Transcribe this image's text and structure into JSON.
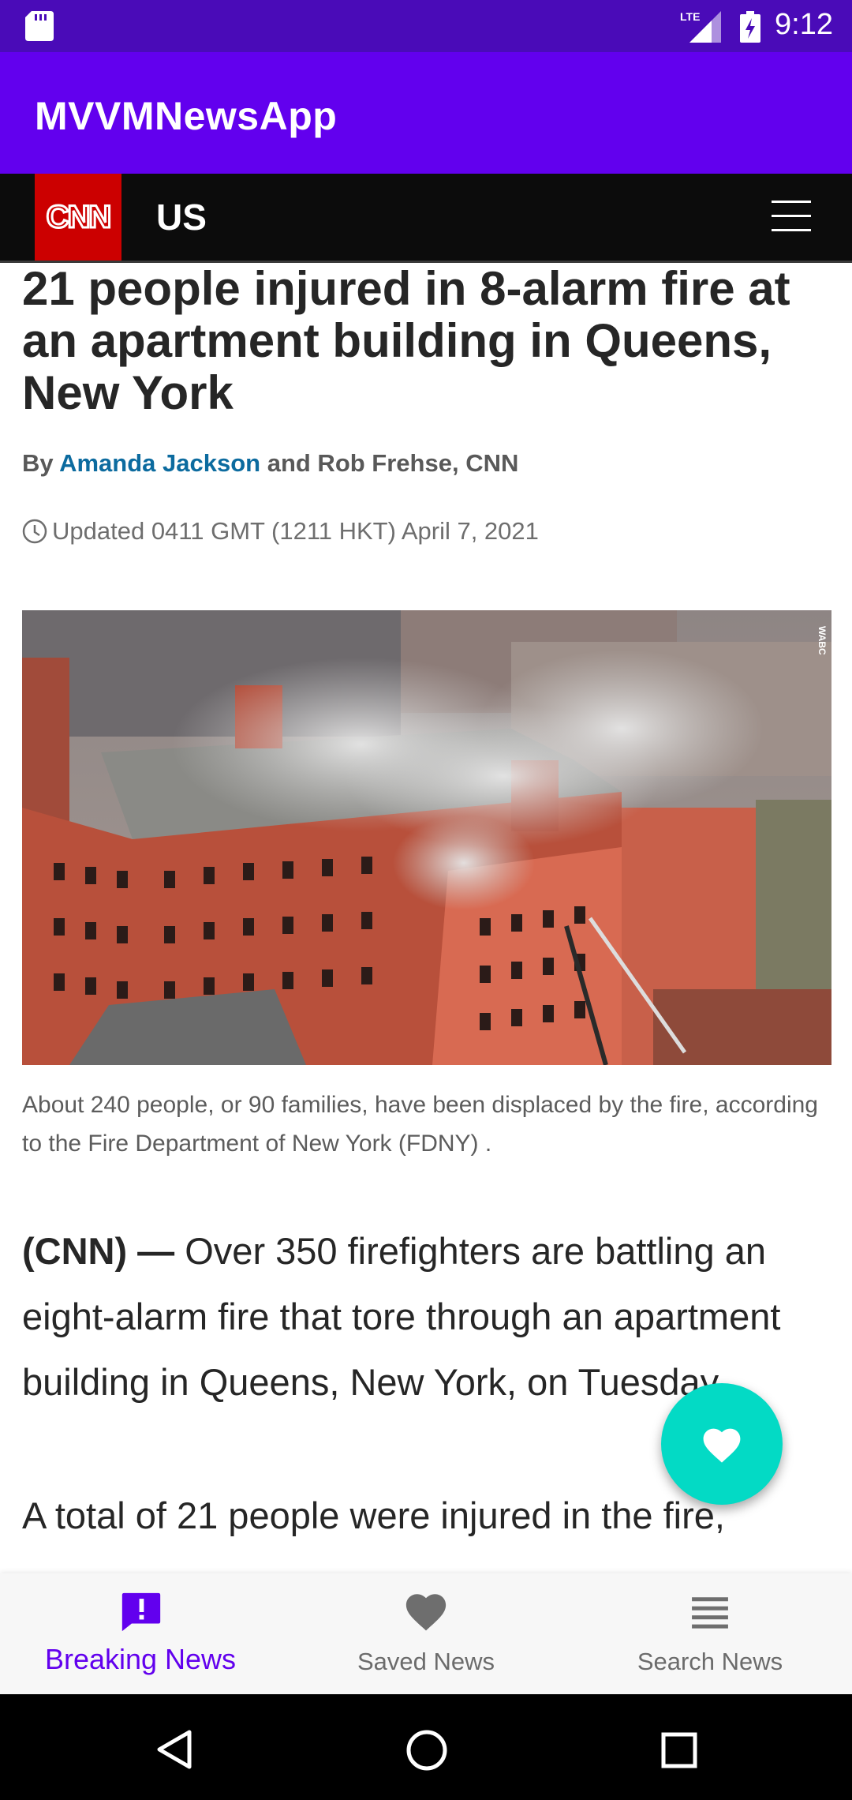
{
  "status_bar": {
    "time": "9:12",
    "network": "LTE"
  },
  "app_bar": {
    "title": "MVVMNewsApp"
  },
  "cnn_header": {
    "logo": "CNN",
    "section": "US"
  },
  "article": {
    "headline": "21 people injured in 8-alarm fire at an apartment building in Queens, New York",
    "byline_prefix": "By ",
    "author": "Amanda Jackson",
    "byline_suffix": " and Rob Frehse, CNN",
    "updated": "Updated 0411 GMT (1211 HKT) April 7, 2021",
    "photo_watermark": "WABC",
    "caption": "About 240 people, or 90 families, have been displaced by the fire, according to the Fire Department of New York (FDNY) .",
    "lead": "(CNN) —",
    "paragraph1": " Over 350 firefighters are battling an eight-alarm fire that tore through an apartment building in Queens, New York, on Tuesday.",
    "paragraph2": "A total of 21 people were injured in the fire,"
  },
  "fab": {
    "icon": "heart-icon"
  },
  "bottom_nav": {
    "items": [
      {
        "label": "Breaking News",
        "icon": "alert-icon",
        "active": true
      },
      {
        "label": "Saved News",
        "icon": "heart-icon",
        "active": false
      },
      {
        "label": "Search News",
        "icon": "list-icon",
        "active": false
      }
    ]
  },
  "colors": {
    "primary": "#6200ee",
    "primary_dark": "#4a0bb8",
    "accent": "#03dac5",
    "cnn_red": "#cc0000",
    "link": "#0c6b9f"
  }
}
